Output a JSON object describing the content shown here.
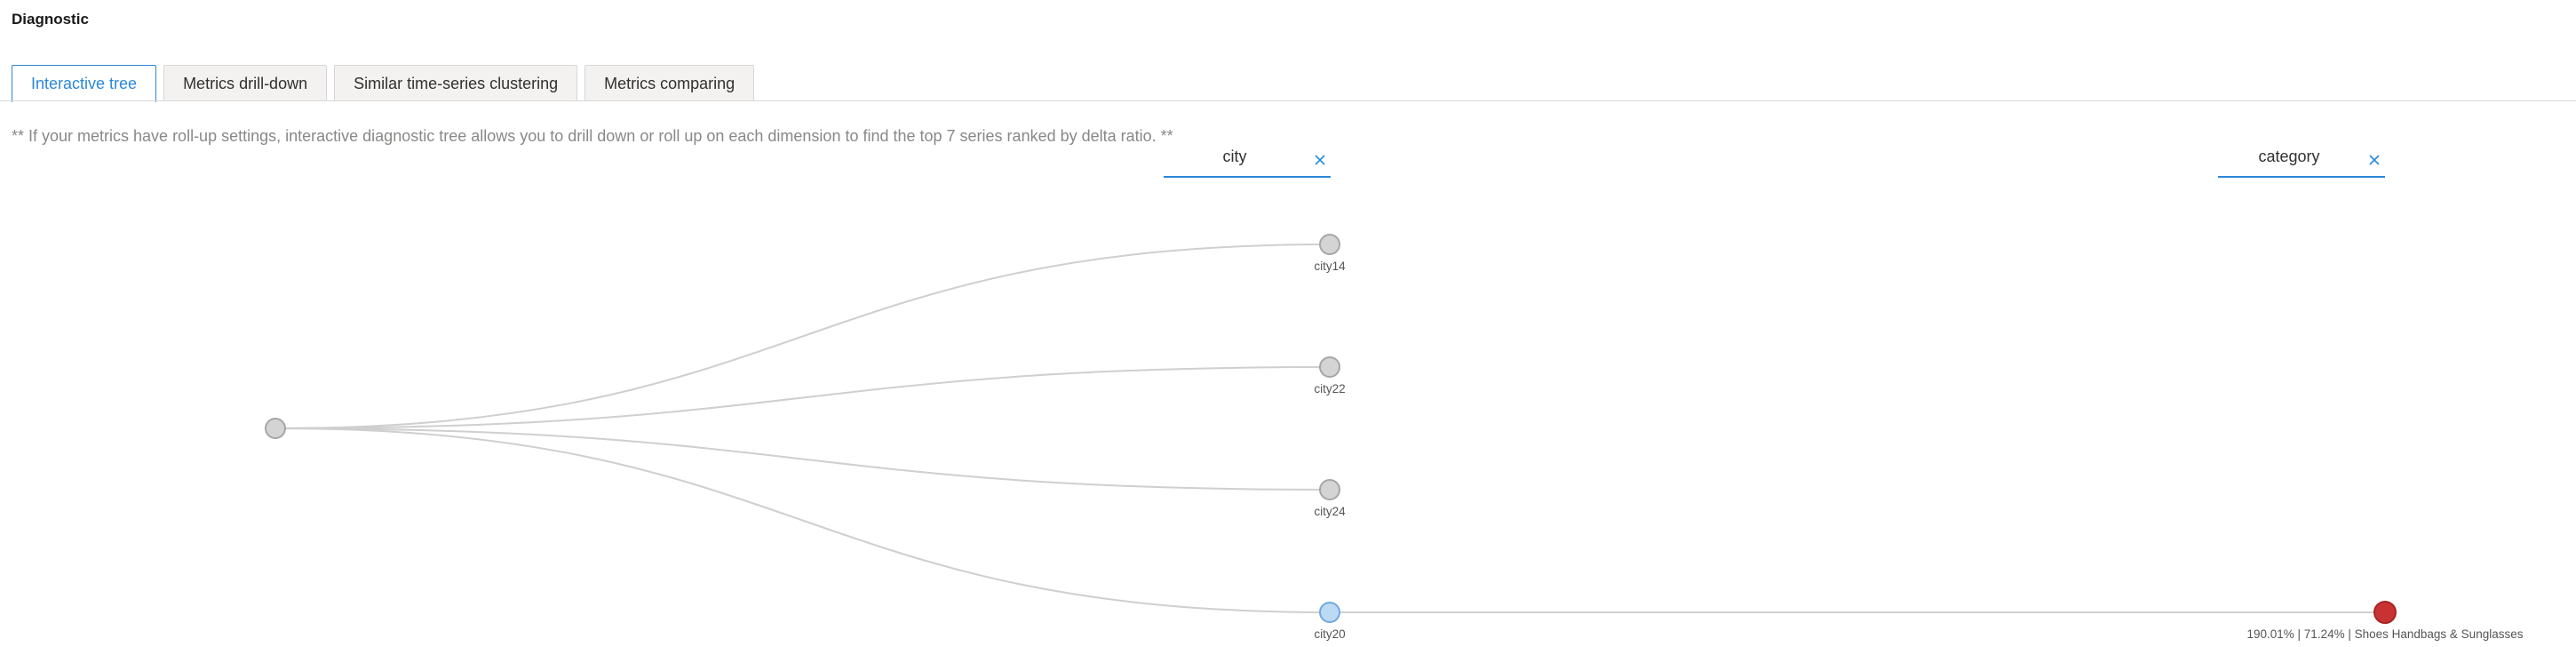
{
  "header": {
    "title": "Diagnostic"
  },
  "tabs": [
    {
      "label": "Interactive tree",
      "active": true
    },
    {
      "label": "Metrics drill-down",
      "active": false
    },
    {
      "label": "Similar time-series clustering",
      "active": false
    },
    {
      "label": "Metrics comparing",
      "active": false
    }
  ],
  "note": "** If your metrics have roll-up settings, interactive diagnostic tree allows you to drill down or roll up on each dimension to find the top 7 series ranked by delta ratio. **",
  "dimension_selectors": [
    {
      "label": "city",
      "clear_icon": "close-icon"
    },
    {
      "label": "category",
      "clear_icon": "close-icon"
    }
  ],
  "tree": {
    "root": {
      "label": ""
    },
    "level1": [
      {
        "label": "city14",
        "state": "default"
      },
      {
        "label": "city22",
        "state": "default"
      },
      {
        "label": "city24",
        "state": "default"
      },
      {
        "label": "city20",
        "state": "selected"
      }
    ],
    "level2": [
      {
        "label": "190.01% | 71.24% | Shoes Handbags & Sunglasses",
        "parent": "city20",
        "state": "anomaly"
      }
    ]
  },
  "colors": {
    "accent": "#2b88d8",
    "node_default_fill": "#d4d4d4",
    "node_default_stroke": "#a6a6a6",
    "node_selected_fill": "#bcd9f5",
    "node_selected_stroke": "#6fa8e0",
    "node_anomaly_fill": "#c93232",
    "node_anomaly_stroke": "#a82424",
    "link": "#cfcfcf"
  }
}
